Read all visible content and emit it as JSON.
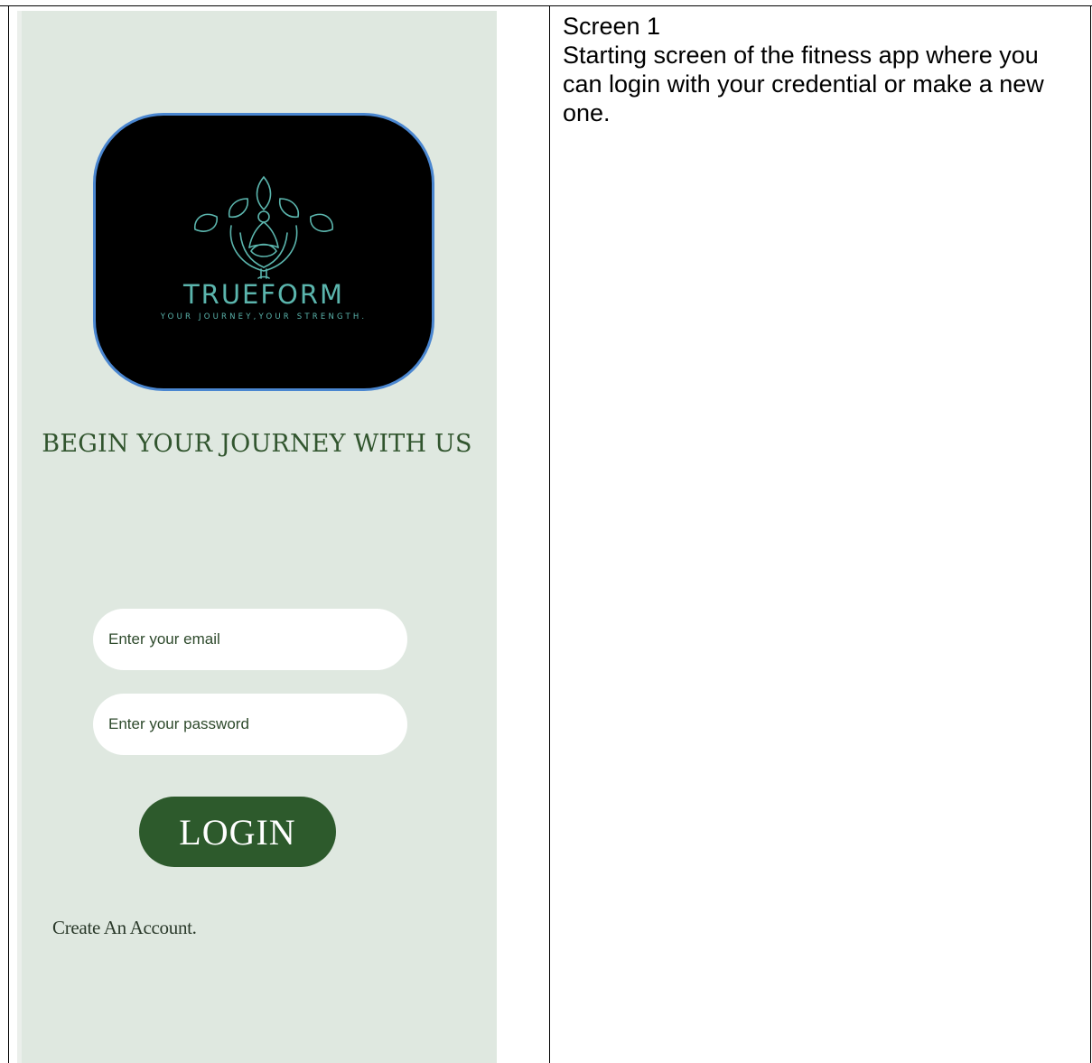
{
  "screen": {
    "logo": {
      "name": "TRUEFORM",
      "tagline": "YOUR JOURNEY,YOUR STRENGTH.",
      "icon": "lotus-meditation-icon"
    },
    "headline": "BEGIN YOUR JOURNEY WITH US",
    "email_placeholder": "Enter your email",
    "password_placeholder": "Enter your password",
    "login_label": "LOGIN",
    "create_account_label": "Create An Account."
  },
  "description": {
    "title": "Screen 1",
    "text": "Starting screen of the fitness app where you can login with your credential or make a new one."
  },
  "colors": {
    "phone_background": "#dfe8e0",
    "brand_green": "#2d5a2c",
    "logo_teal": "#5bb5ad",
    "logo_border": "#4a86d0"
  }
}
